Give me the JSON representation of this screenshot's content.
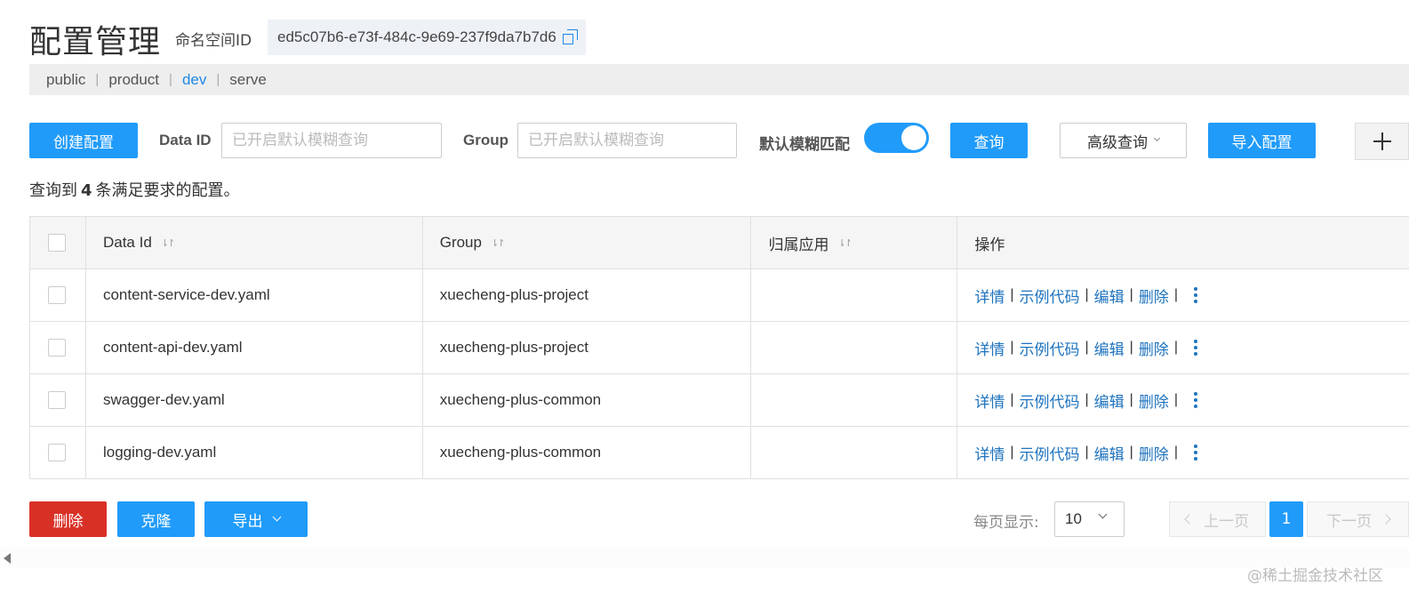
{
  "header": {
    "title": "配置管理",
    "namespace_label": "命名空间ID",
    "namespace_id": "ed5c07b6-e73f-484c-9e69-237f9da7b7d6"
  },
  "namespaces": [
    {
      "label": "public",
      "active": false
    },
    {
      "label": "product",
      "active": false
    },
    {
      "label": "dev",
      "active": true
    },
    {
      "label": "serve",
      "active": false
    }
  ],
  "toolbar": {
    "create_label": "创建配置",
    "data_id_label": "Data ID",
    "data_id_placeholder": "已开启默认模糊查询",
    "group_label": "Group",
    "group_placeholder": "已开启默认模糊查询",
    "fuzzy_label": "默认模糊匹配",
    "fuzzy_on": true,
    "search_label": "查询",
    "advanced_label": "高级查询",
    "import_label": "导入配置"
  },
  "result": {
    "prefix": "查询到",
    "count": "4",
    "suffix": "条满足要求的配置。"
  },
  "table": {
    "headers": [
      "Data Id",
      "Group",
      "归属应用",
      "操作"
    ],
    "rows": [
      {
        "data_id": "content-service-dev.yaml",
        "group": "xuecheng-plus-project",
        "app": ""
      },
      {
        "data_id": "content-api-dev.yaml",
        "group": "xuecheng-plus-project",
        "app": ""
      },
      {
        "data_id": "swagger-dev.yaml",
        "group": "xuecheng-plus-common",
        "app": ""
      },
      {
        "data_id": "logging-dev.yaml",
        "group": "xuecheng-plus-common",
        "app": ""
      }
    ],
    "actions": {
      "detail": "详情",
      "sample": "示例代码",
      "edit": "编辑",
      "delete": "删除",
      "sep": "|"
    }
  },
  "footer": {
    "delete_label": "删除",
    "clone_label": "克隆",
    "export_label": "导出",
    "page_size_label": "每页显示:",
    "page_size": "10",
    "prev_label": "上一页",
    "next_label": "下一页",
    "current_page": "1"
  },
  "watermark": "@稀土掘金技术社区",
  "colors": {
    "primary": "#209bfa",
    "danger": "#d93026",
    "link": "#1e73be"
  }
}
